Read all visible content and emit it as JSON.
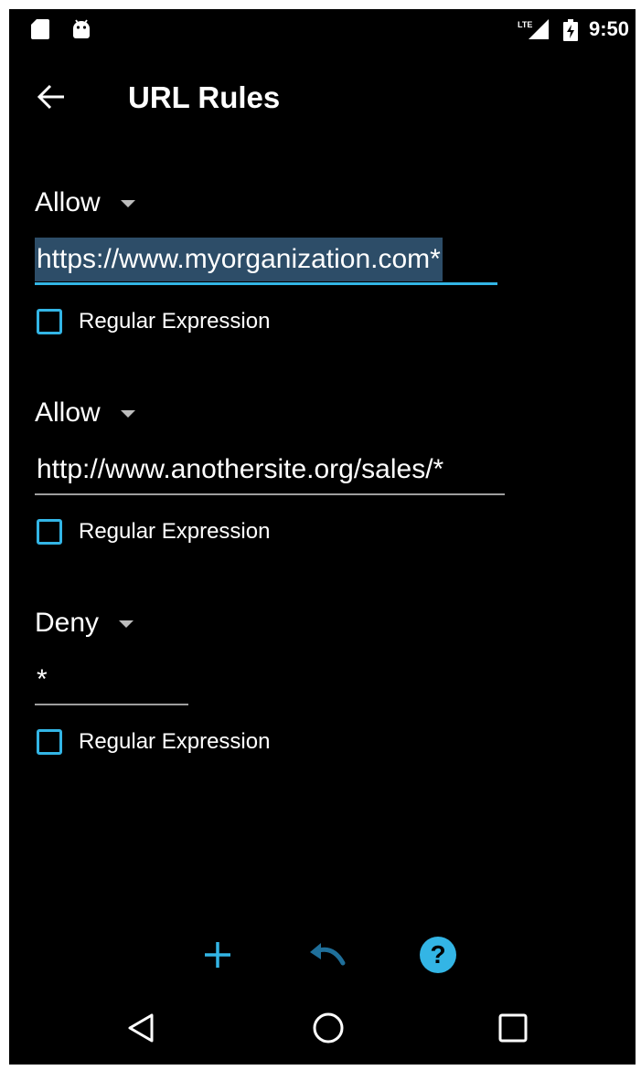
{
  "status_bar": {
    "time": "9:50",
    "icons": [
      "sd-card-icon",
      "android-icon",
      "lte-signal-icon",
      "battery-charging-icon"
    ],
    "network_label": "LTE"
  },
  "app_bar": {
    "title": "URL Rules",
    "back_icon": "arrow-back-icon"
  },
  "rules": [
    {
      "policy": "Allow",
      "url": "https://www.myorganization.com*",
      "url_selected": true,
      "regex_label": "Regular Expression",
      "regex_checked": false
    },
    {
      "policy": "Allow",
      "url": "http://www.anothersite.org/sales/*",
      "url_selected": false,
      "regex_label": "Regular Expression",
      "regex_checked": false
    },
    {
      "policy": "Deny",
      "url": "*",
      "url_selected": false,
      "regex_label": "Regular Expression",
      "regex_checked": false
    }
  ],
  "toolbar": {
    "add_icon": "plus-icon",
    "undo_icon": "undo-icon",
    "help_icon": "help-icon"
  },
  "nav_bar": {
    "back_icon": "nav-back-icon",
    "home_icon": "nav-home-icon",
    "recents_icon": "nav-recents-icon"
  },
  "colors": {
    "background": "#000000",
    "accent": "#33b5e5",
    "undo_dim": "#1f6f9a",
    "selection": "#2d4d68",
    "underline": "#9e9e9e",
    "text": "#ffffff"
  }
}
